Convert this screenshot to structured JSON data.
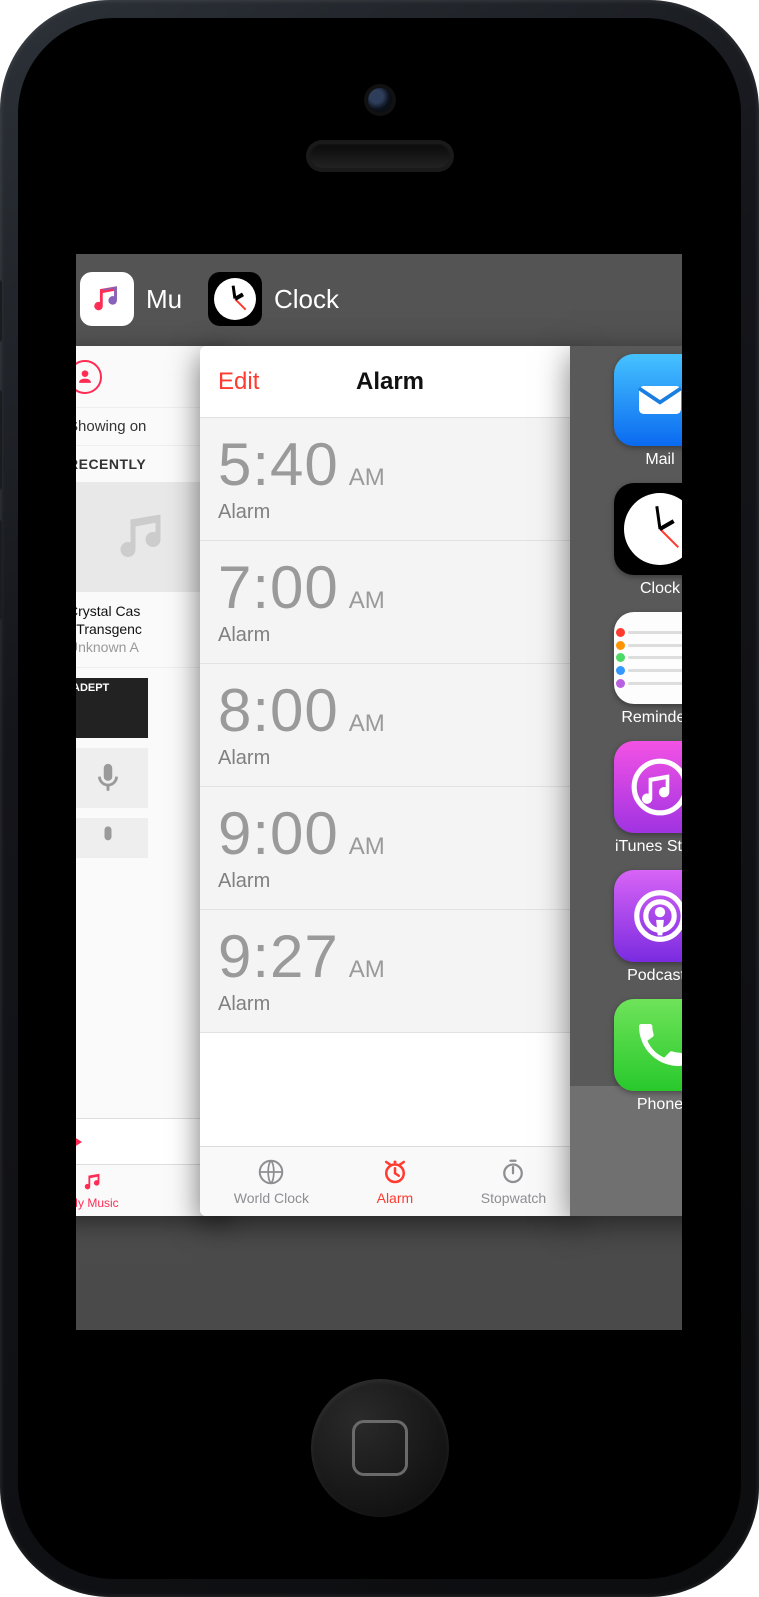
{
  "switcher": {
    "music_label": "Mu",
    "clock_label": "Clock"
  },
  "music": {
    "showing": "Showing on",
    "recently": "RECENTLY",
    "track_title": "Crystal Cas",
    "track_sub": "- Transgenc",
    "track_artist": "Unknown A",
    "adept": "ADEPT",
    "tab_my_music": "My Music"
  },
  "clock": {
    "edit": "Edit",
    "title": "Alarm",
    "alarms": [
      {
        "time": "5:40",
        "ampm": "AM",
        "label": "Alarm"
      },
      {
        "time": "7:00",
        "ampm": "AM",
        "label": "Alarm"
      },
      {
        "time": "8:00",
        "ampm": "AM",
        "label": "Alarm"
      },
      {
        "time": "9:00",
        "ampm": "AM",
        "label": "Alarm"
      },
      {
        "time": "9:27",
        "ampm": "AM",
        "label": "Alarm"
      }
    ],
    "tabs": {
      "world": "World Clock",
      "alarm": "Alarm",
      "stopwatch": "Stopwatch"
    }
  },
  "home_apps": [
    {
      "name": "Mail"
    },
    {
      "name": "Clock"
    },
    {
      "name": "Reminders"
    },
    {
      "name": "iTunes Store"
    },
    {
      "name": "Podcasts"
    },
    {
      "name": "Phone"
    }
  ]
}
